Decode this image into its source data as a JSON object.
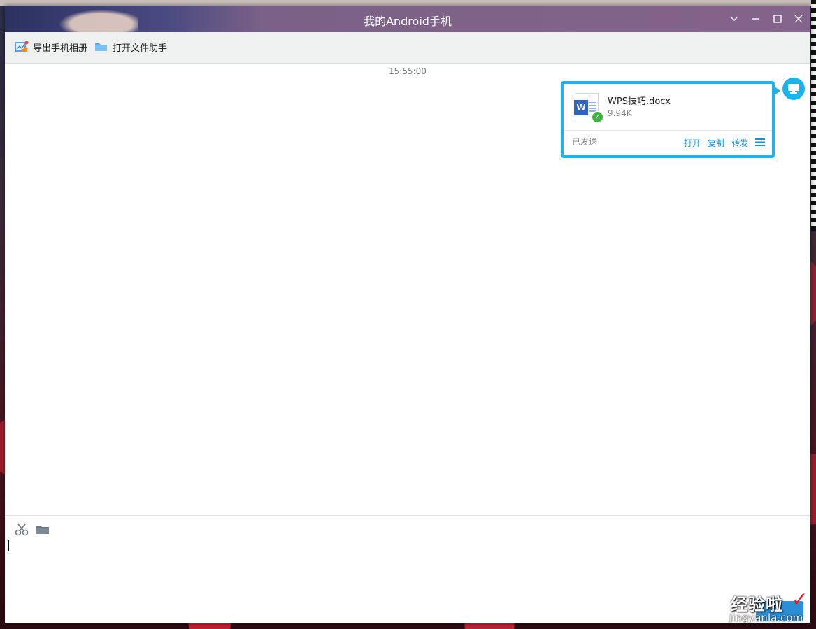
{
  "window": {
    "title": "我的Android手机",
    "controls": [
      "dropdown-icon",
      "minimize-icon",
      "maximize-icon",
      "close-icon"
    ]
  },
  "toolbar": {
    "export_album_label": "导出手机相册",
    "open_file_assistant_label": "打开文件助手"
  },
  "chat": {
    "timestamp": "15:55:00",
    "message": {
      "file_name": "WPS技巧.docx",
      "file_size": "9.94K",
      "file_icon": "word-doc-icon",
      "status": "已发送",
      "actions": {
        "open": "打开",
        "copy": "复制",
        "forward": "转发"
      },
      "sender_avatar_icon": "computer-icon"
    }
  },
  "input": {
    "icons": [
      "scissors-icon",
      "folder-icon"
    ],
    "value": ""
  },
  "watermark": {
    "text": "经验啦",
    "url": "jingyanla.com"
  },
  "colors": {
    "accent": "#1cb3ec",
    "link": "#1a8fd8",
    "sent_check": "#3fb541"
  }
}
